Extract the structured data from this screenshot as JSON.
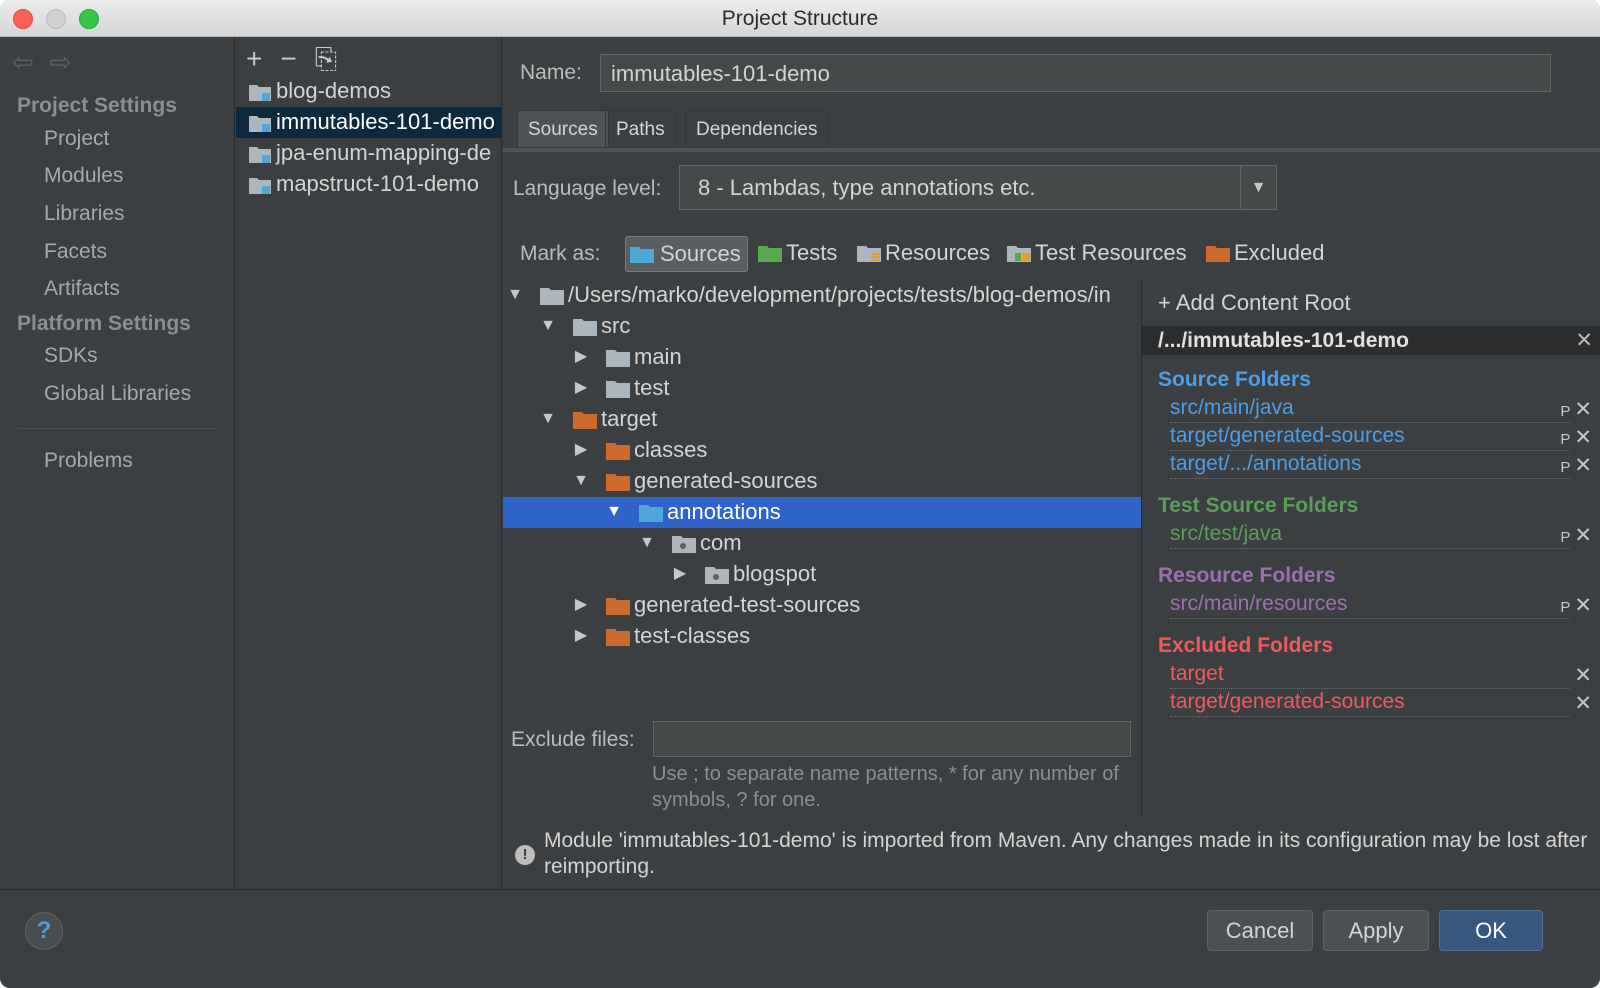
{
  "window": {
    "title": "Project Structure"
  },
  "nav": {
    "back_icon": "back-arrow-icon",
    "forward_icon": "forward-arrow-icon",
    "project_settings": "Project Settings",
    "project_items": [
      "Project",
      "Modules",
      "Libraries",
      "Facets",
      "Artifacts"
    ],
    "platform_settings": "Platform Settings",
    "platform_items": [
      "SDKs",
      "Global Libraries"
    ],
    "problems": "Problems"
  },
  "modules": {
    "toolbar": {
      "add": "+",
      "remove": "−",
      "copy": "⎘"
    },
    "items": [
      "blog-demos",
      "immutables-101-demo",
      "jpa-enum-mapping-de",
      "mapstruct-101-demo"
    ],
    "selected": "immutables-101-demo"
  },
  "detail": {
    "name_label": "Name:",
    "name_value": "immutables-101-demo",
    "tabs": [
      "Sources",
      "Paths",
      "Dependencies"
    ],
    "active_tab": "Sources",
    "language_label": "Language level:",
    "language_value": "8 - Lambdas, type annotations etc.",
    "mark_label": "Mark as:",
    "mark_buttons": [
      "Sources",
      "Tests",
      "Resources",
      "Test Resources",
      "Excluded"
    ],
    "tree": [
      {
        "text": "/Users/marko/development/projects/tests/blog-demos/in",
        "state": "open"
      },
      {
        "text": "src",
        "state": "open"
      },
      {
        "text": "main",
        "state": "closed"
      },
      {
        "text": "test",
        "state": "closed"
      },
      {
        "text": "target",
        "state": "open"
      },
      {
        "text": "classes",
        "state": "closed"
      },
      {
        "text": "generated-sources",
        "state": "open"
      },
      {
        "text": "annotations",
        "state": "open"
      },
      {
        "text": "com",
        "state": "open"
      },
      {
        "text": "blogspot",
        "state": "closed"
      },
      {
        "text": "generated-test-sources",
        "state": "closed"
      },
      {
        "text": "test-classes",
        "state": "closed"
      }
    ],
    "selected_tree_item": "annotations",
    "exclude_label": "Exclude files:",
    "exclude_value": "",
    "exclude_hint": "Use ; to separate name patterns, * for any number of symbols, ? for one.",
    "warning": "Module 'immutables-101-demo' is imported from Maven. Any changes made in its configuration may be lost after reimporting."
  },
  "roots": {
    "add_content_root": "Add Content Root",
    "root_path": "/.../immutables-101-demo",
    "source_title": "Source Folders",
    "source_folders": [
      "src/main/java",
      "target/generated-sources",
      "target/.../annotations"
    ],
    "test_title": "Test Source Folders",
    "test_folders": [
      "src/test/java"
    ],
    "resource_title": "Resource Folders",
    "resource_folders": [
      "src/main/resources"
    ],
    "excluded_title": "Excluded Folders",
    "excluded_folders": [
      "target",
      "target/generated-sources"
    ]
  },
  "buttons": {
    "help": "?",
    "cancel": "Cancel",
    "apply": "Apply",
    "ok": "OK"
  },
  "colors": {
    "source": "#4a9fe8",
    "test": "#5a9e5a",
    "resource": "#9d6fb0",
    "excluded": "#f05a5a",
    "selection": "#2f65ca",
    "folder_source": "#4fa8d8",
    "folder_test": "#59a84b",
    "folder_excluded": "#cc6a30",
    "folder_plain": "#aeb6bd"
  }
}
